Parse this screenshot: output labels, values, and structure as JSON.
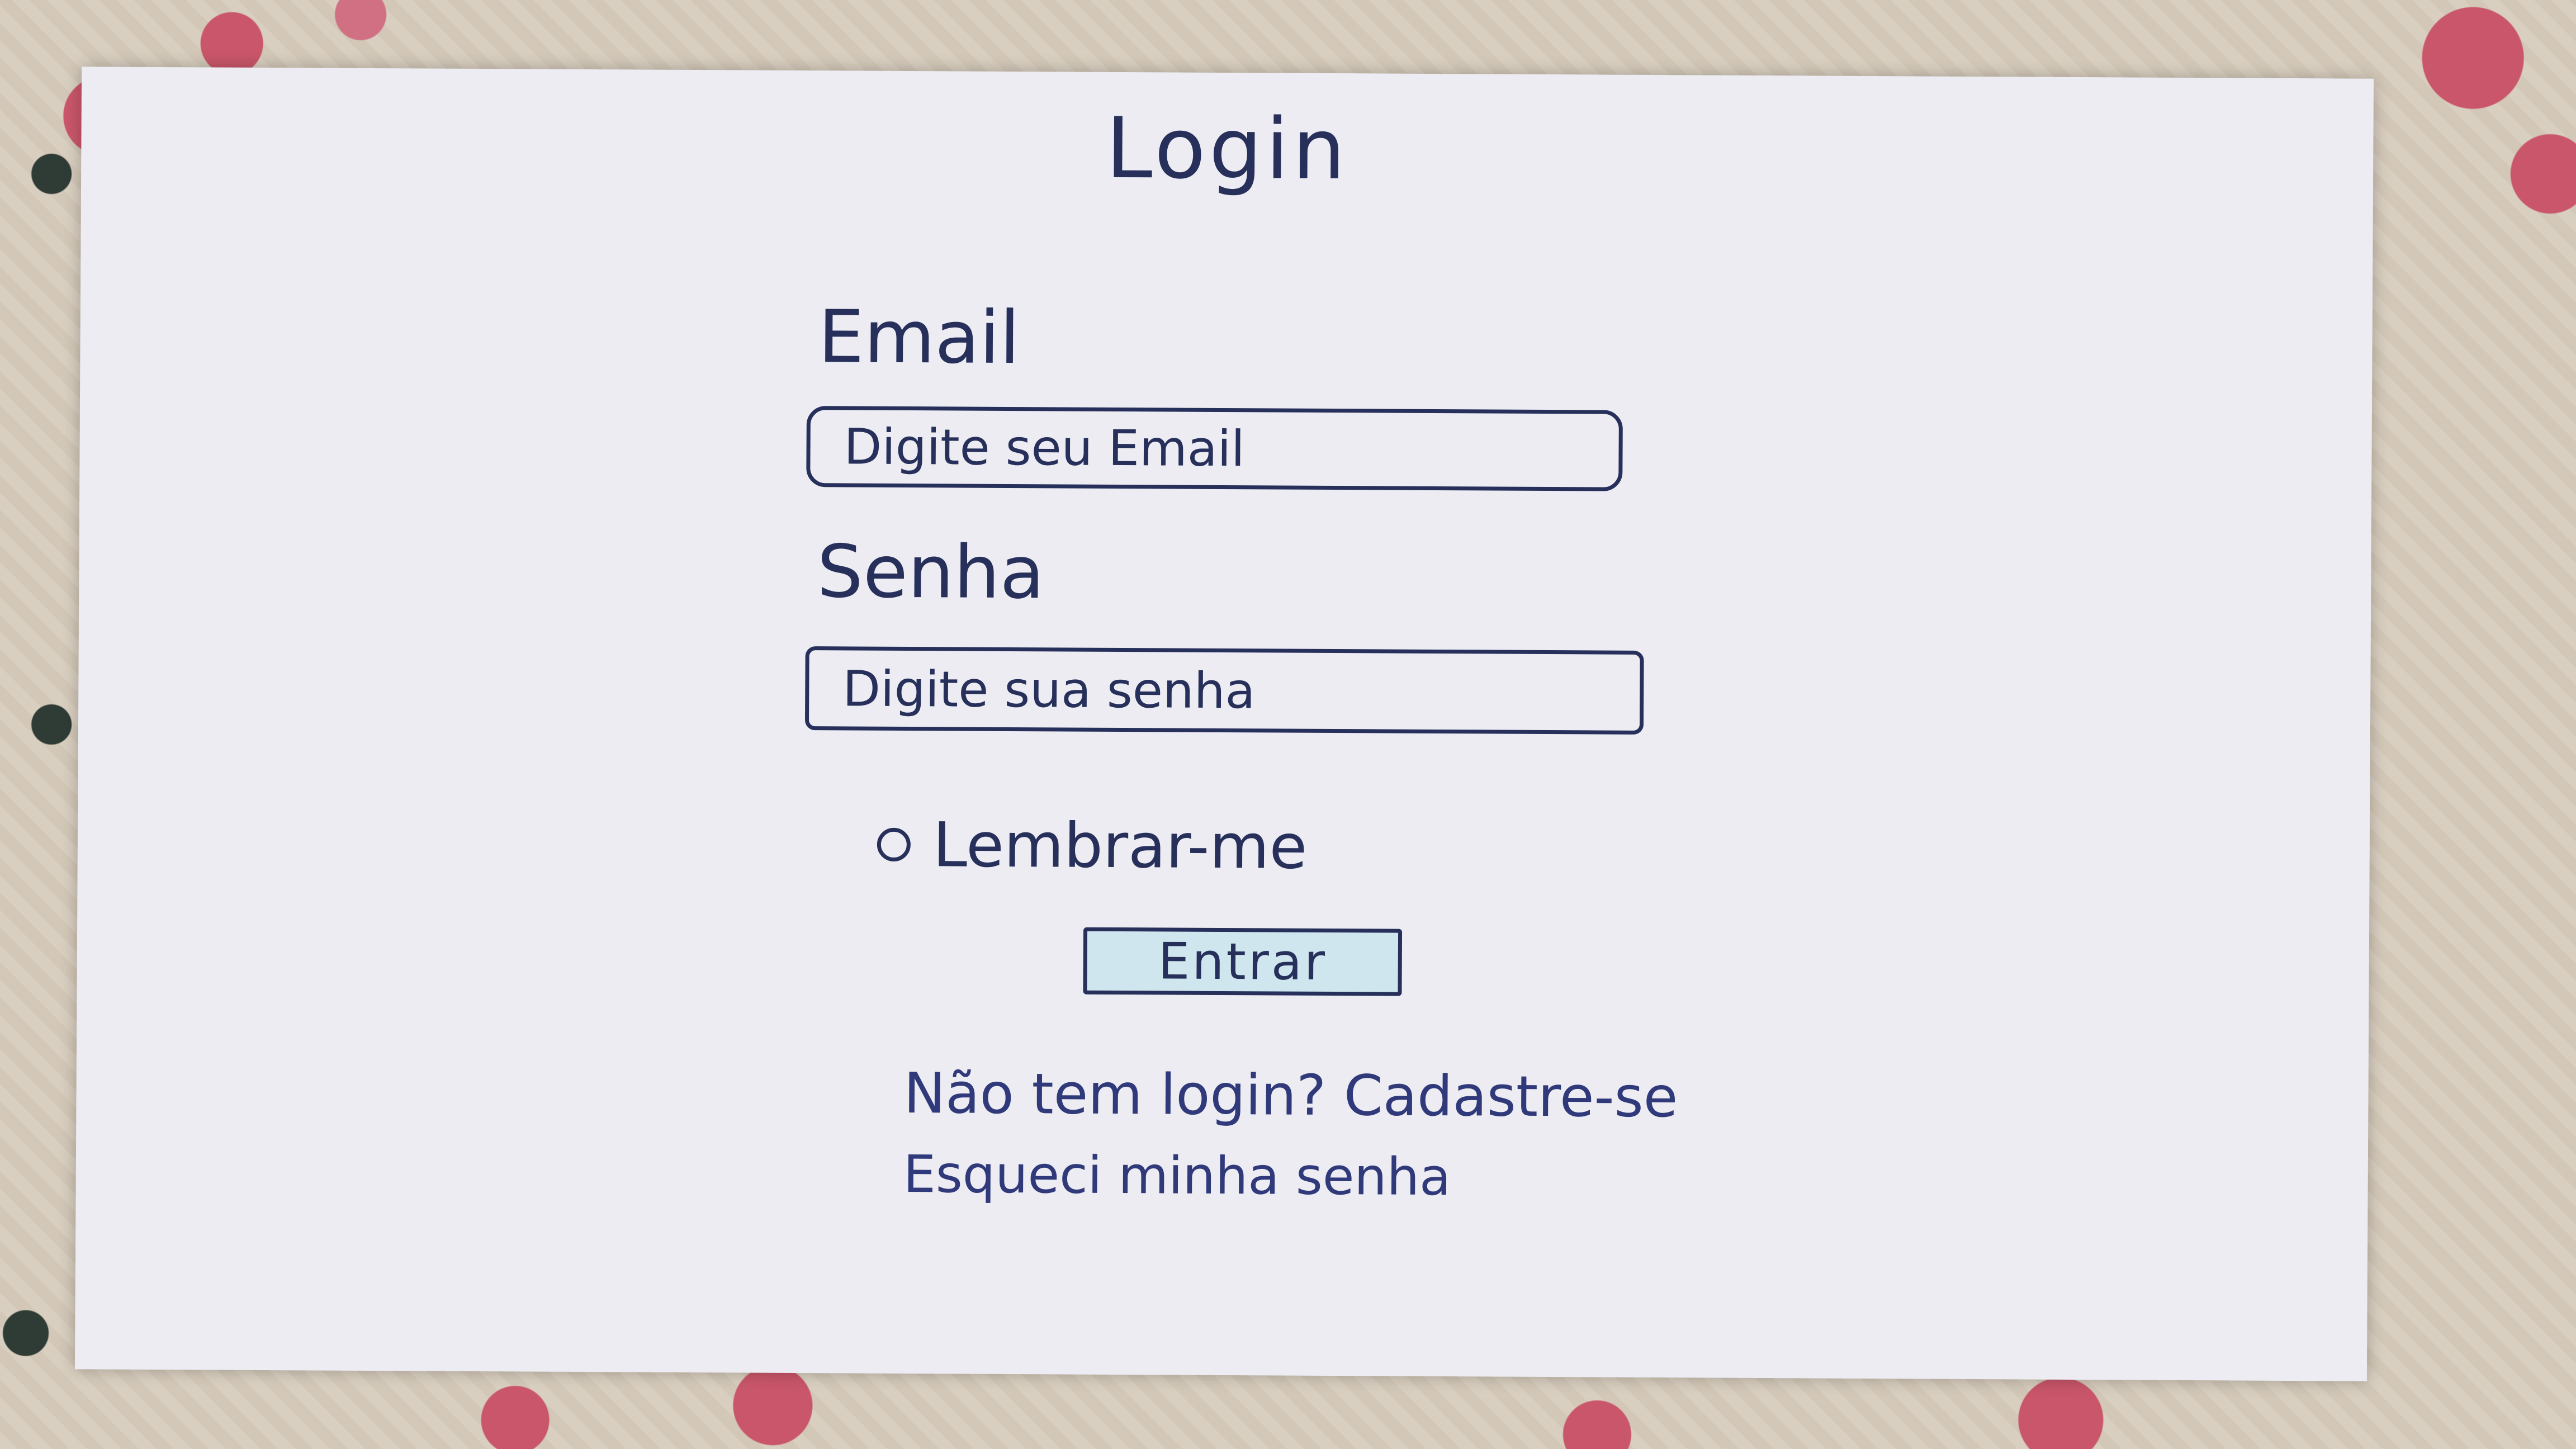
{
  "login_form": {
    "title": "Login",
    "email_label": "Email",
    "email_placeholder": "Digite seu Email",
    "password_label": "Senha",
    "password_placeholder": "Digite sua senha",
    "remember_label": "Lembrar-me",
    "remember_checked": false,
    "submit_label": "Entrar",
    "signup_link": "Não tem login? Cadastre-se",
    "forgot_link": "Esqueci minha senha"
  },
  "colors": {
    "ink": "#27305a",
    "paper": "#ececf2",
    "button_fill": "#cfe6ef"
  }
}
